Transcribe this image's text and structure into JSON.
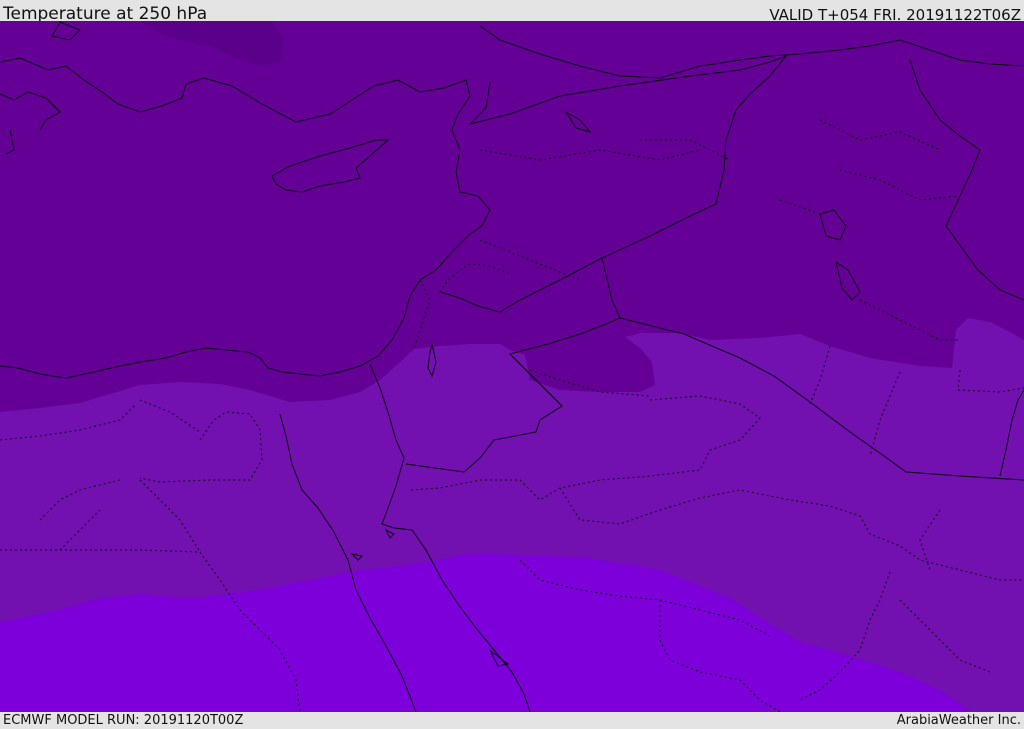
{
  "header": {
    "title": "Temperature at 250 hPa",
    "valid": "VALID T+054 FRI. 20191122T06Z"
  },
  "footer": {
    "model_run": "ECMWF MODEL RUN: 20191120T00Z",
    "credit": "ArabiaWeather Inc."
  },
  "map": {
    "colors": {
      "band_cold": "#650096",
      "band_colder_patch": "#5a008a",
      "band_mid": "#7310b0",
      "band_warm": "#7d00da",
      "lines": "#0a0014"
    }
  }
}
